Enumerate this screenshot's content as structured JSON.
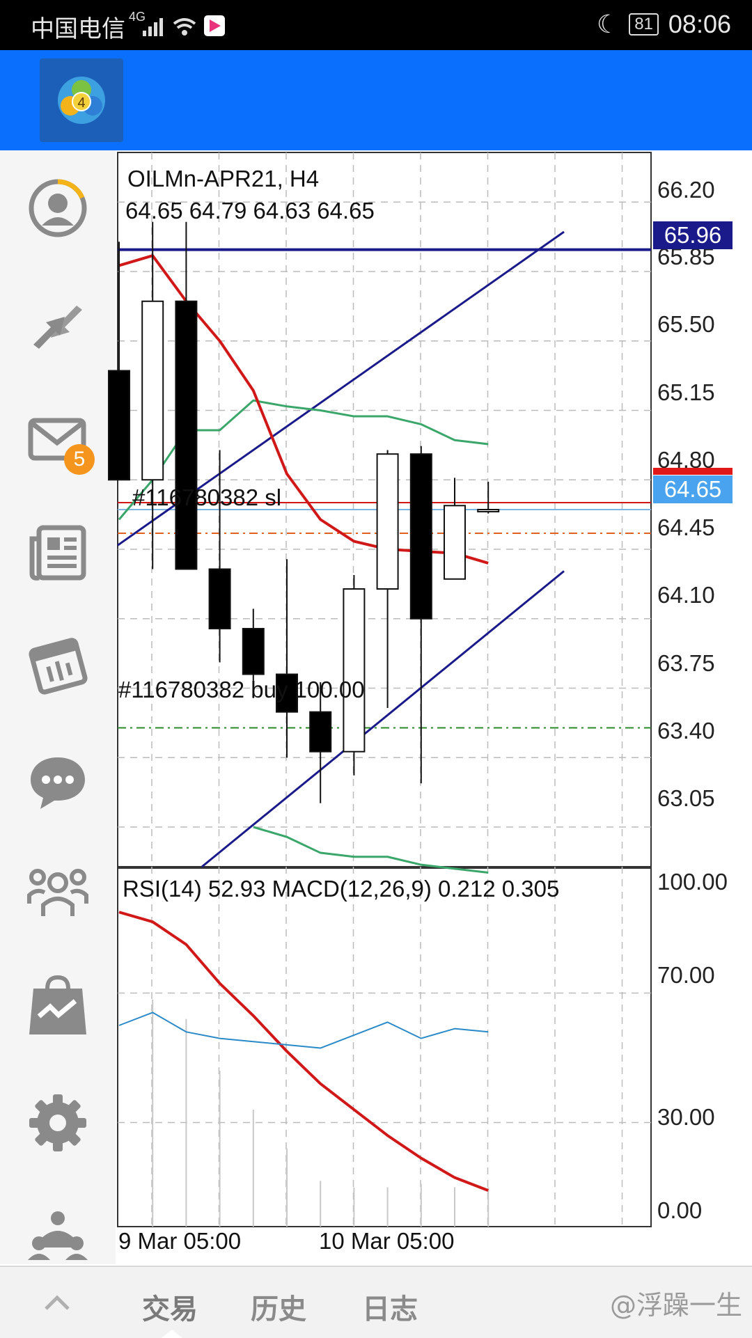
{
  "status_bar": {
    "carrier": "中国电信",
    "network": "4G",
    "battery": "81",
    "time": "08:06"
  },
  "sidebar": {
    "items": [
      {
        "name": "account-icon"
      },
      {
        "name": "trade-arrows-icon"
      },
      {
        "name": "mail-icon",
        "badge": "5"
      },
      {
        "name": "news-icon"
      },
      {
        "name": "calendar-icon"
      },
      {
        "name": "chat-icon"
      },
      {
        "name": "community-icon"
      },
      {
        "name": "market-bag-icon"
      },
      {
        "name": "settings-gear-icon"
      },
      {
        "name": "traders-icon"
      }
    ]
  },
  "chart": {
    "symbol_timeframe": "OILMn-APR21, H4",
    "ohlc": "64.65 64.79 64.63 64.65",
    "price_axis": [
      "66.20",
      "65.85",
      "65.50",
      "65.15",
      "64.80",
      "64.45",
      "64.10",
      "63.75",
      "63.40",
      "63.05"
    ],
    "hline_price": "65.96",
    "current_price": "64.65",
    "sl_label": "#116780382 sl",
    "order_label": "#116780382 buy 100.00",
    "indicator_title": "RSI(14) 52.93 MACD(12,26,9) 0.212 0.305",
    "indicator_axis": [
      "100.00",
      "70.00",
      "30.00",
      "0.00"
    ],
    "time_labels": [
      "9 Mar 05:00",
      "10 Mar 05:00"
    ],
    "colors": {
      "bull": "#ffffff",
      "bear": "#000000",
      "ma_red": "#d01818",
      "band_green": "#3aa66a",
      "trend_navy": "#1a1a8a",
      "rsi_blue": "#2a8ac8"
    }
  },
  "chart_data": {
    "type": "candlestick",
    "ylim": [
      62.85,
      66.45
    ],
    "candles": [
      {
        "o": 65.35,
        "h": 66.0,
        "l": 64.8,
        "c": 64.8
      },
      {
        "o": 64.8,
        "h": 66.1,
        "l": 64.35,
        "c": 65.7
      },
      {
        "o": 65.7,
        "h": 66.1,
        "l": 64.35,
        "c": 64.35
      },
      {
        "o": 64.35,
        "h": 64.95,
        "l": 63.88,
        "c": 64.05
      },
      {
        "o": 64.05,
        "h": 64.15,
        "l": 63.7,
        "c": 63.82
      },
      {
        "o": 63.82,
        "h": 64.4,
        "l": 63.4,
        "c": 63.63
      },
      {
        "o": 63.63,
        "h": 63.78,
        "l": 63.17,
        "c": 63.43
      },
      {
        "o": 63.43,
        "h": 64.32,
        "l": 63.31,
        "c": 64.25
      },
      {
        "o": 64.25,
        "h": 64.95,
        "l": 63.65,
        "c": 64.93
      },
      {
        "o": 64.93,
        "h": 64.97,
        "l": 63.27,
        "c": 64.1
      },
      {
        "o": 64.3,
        "h": 64.81,
        "l": 64.3,
        "c": 64.67
      },
      {
        "o": 64.65,
        "h": 64.79,
        "l": 64.63,
        "c": 64.65
      }
    ],
    "ma_red": [
      65.88,
      65.93,
      65.7,
      65.5,
      65.25,
      64.83,
      64.6,
      64.49,
      64.45,
      64.44,
      64.43,
      64.38
    ],
    "band_upper": [
      64.6,
      64.8,
      65.05,
      65.05,
      65.2,
      65.17,
      65.15,
      65.12,
      65.12,
      65.08,
      65.0,
      64.98
    ],
    "band_lower": [
      null,
      null,
      null,
      null,
      63.05,
      63.0,
      62.92,
      62.9,
      62.9,
      62.86,
      62.84,
      62.82
    ],
    "rsi": [
      60,
      64,
      58,
      56,
      55,
      54,
      53,
      57,
      61,
      56,
      59,
      58
    ],
    "macd_signal": [
      95,
      92,
      85,
      73,
      63,
      52,
      42,
      34,
      26,
      19,
      13,
      9
    ],
    "macd_hist": [
      0,
      68,
      62,
      46,
      34,
      22,
      12,
      10,
      10,
      11,
      10,
      10
    ],
    "rsi_ylim": [
      0,
      100
    ]
  },
  "bottom_bar": {
    "tabs": [
      "交易",
      "历史",
      "日志"
    ],
    "watermark": "@浮躁一生"
  }
}
